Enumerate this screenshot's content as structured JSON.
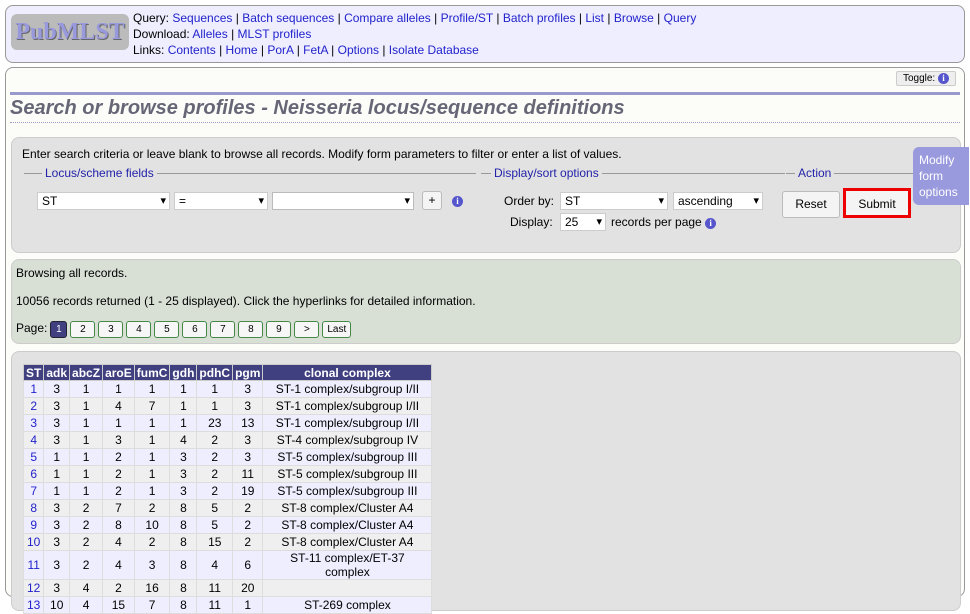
{
  "header": {
    "logo": "PubMLST",
    "query_label": "Query:",
    "query_links": [
      "Sequences",
      "Batch sequences",
      "Compare alleles",
      "Profile/ST",
      "Batch profiles",
      "List",
      "Browse",
      "Query"
    ],
    "download_label": "Download:",
    "download_links": [
      "Alleles",
      "MLST profiles"
    ],
    "links_label": "Links:",
    "links": [
      "Contents",
      "Home",
      "PorA",
      "FetA",
      "Options",
      "Isolate Database"
    ]
  },
  "toggle": "Toggle:",
  "title": "Search or browse profiles - Neisseria locus/sequence definitions",
  "form": {
    "instructions": "Enter search criteria or leave blank to browse all records. Modify form parameters to filter or enter a list of values.",
    "locus_legend": "Locus/scheme fields",
    "field": "ST",
    "operator": "=",
    "value": "",
    "add": "+",
    "display_legend": "Display/sort options",
    "order_label": "Order by:",
    "order_by": "ST",
    "direction": "ascending",
    "display_label": "Display:",
    "per_page": "25",
    "per_page_suffix": "records per page",
    "action_legend": "Action",
    "reset": "Reset",
    "submit": "Submit"
  },
  "modify_tab": "Modify form options",
  "results": {
    "browsing": "Browsing all records.",
    "summary": "10056 records returned (1 - 25 displayed). Click the hyperlinks for detailed information.",
    "page_label": "Page:",
    "pages": [
      "1",
      "2",
      "3",
      "4",
      "5",
      "6",
      "7",
      "8",
      "9",
      ">",
      "Last"
    ],
    "current_page": "1"
  },
  "table": {
    "columns": [
      "ST",
      "adk",
      "abcZ",
      "aroE",
      "fumC",
      "gdh",
      "pdhC",
      "pgm",
      "clonal complex"
    ],
    "rows": [
      [
        "1",
        "3",
        "1",
        "1",
        "1",
        "1",
        "1",
        "3",
        "ST-1 complex/subgroup I/II"
      ],
      [
        "2",
        "3",
        "1",
        "4",
        "7",
        "1",
        "1",
        "3",
        "ST-1 complex/subgroup I/II"
      ],
      [
        "3",
        "3",
        "1",
        "1",
        "1",
        "1",
        "23",
        "13",
        "ST-1 complex/subgroup I/II"
      ],
      [
        "4",
        "3",
        "1",
        "3",
        "1",
        "4",
        "2",
        "3",
        "ST-4 complex/subgroup IV"
      ],
      [
        "5",
        "1",
        "1",
        "2",
        "1",
        "3",
        "2",
        "3",
        "ST-5 complex/subgroup III"
      ],
      [
        "6",
        "1",
        "1",
        "2",
        "1",
        "3",
        "2",
        "11",
        "ST-5 complex/subgroup III"
      ],
      [
        "7",
        "1",
        "1",
        "2",
        "1",
        "3",
        "2",
        "19",
        "ST-5 complex/subgroup III"
      ],
      [
        "8",
        "3",
        "2",
        "7",
        "2",
        "8",
        "5",
        "2",
        "ST-8 complex/Cluster A4"
      ],
      [
        "9",
        "3",
        "2",
        "8",
        "10",
        "8",
        "5",
        "2",
        "ST-8 complex/Cluster A4"
      ],
      [
        "10",
        "3",
        "2",
        "4",
        "2",
        "8",
        "15",
        "2",
        "ST-8 complex/Cluster A4"
      ],
      [
        "11",
        "3",
        "2",
        "4",
        "3",
        "8",
        "4",
        "6",
        "ST-11 complex/ET-37 complex"
      ],
      [
        "12",
        "3",
        "4",
        "2",
        "16",
        "8",
        "11",
        "20",
        ""
      ],
      [
        "13",
        "10",
        "4",
        "15",
        "7",
        "8",
        "11",
        "1",
        "ST-269 complex"
      ]
    ]
  }
}
